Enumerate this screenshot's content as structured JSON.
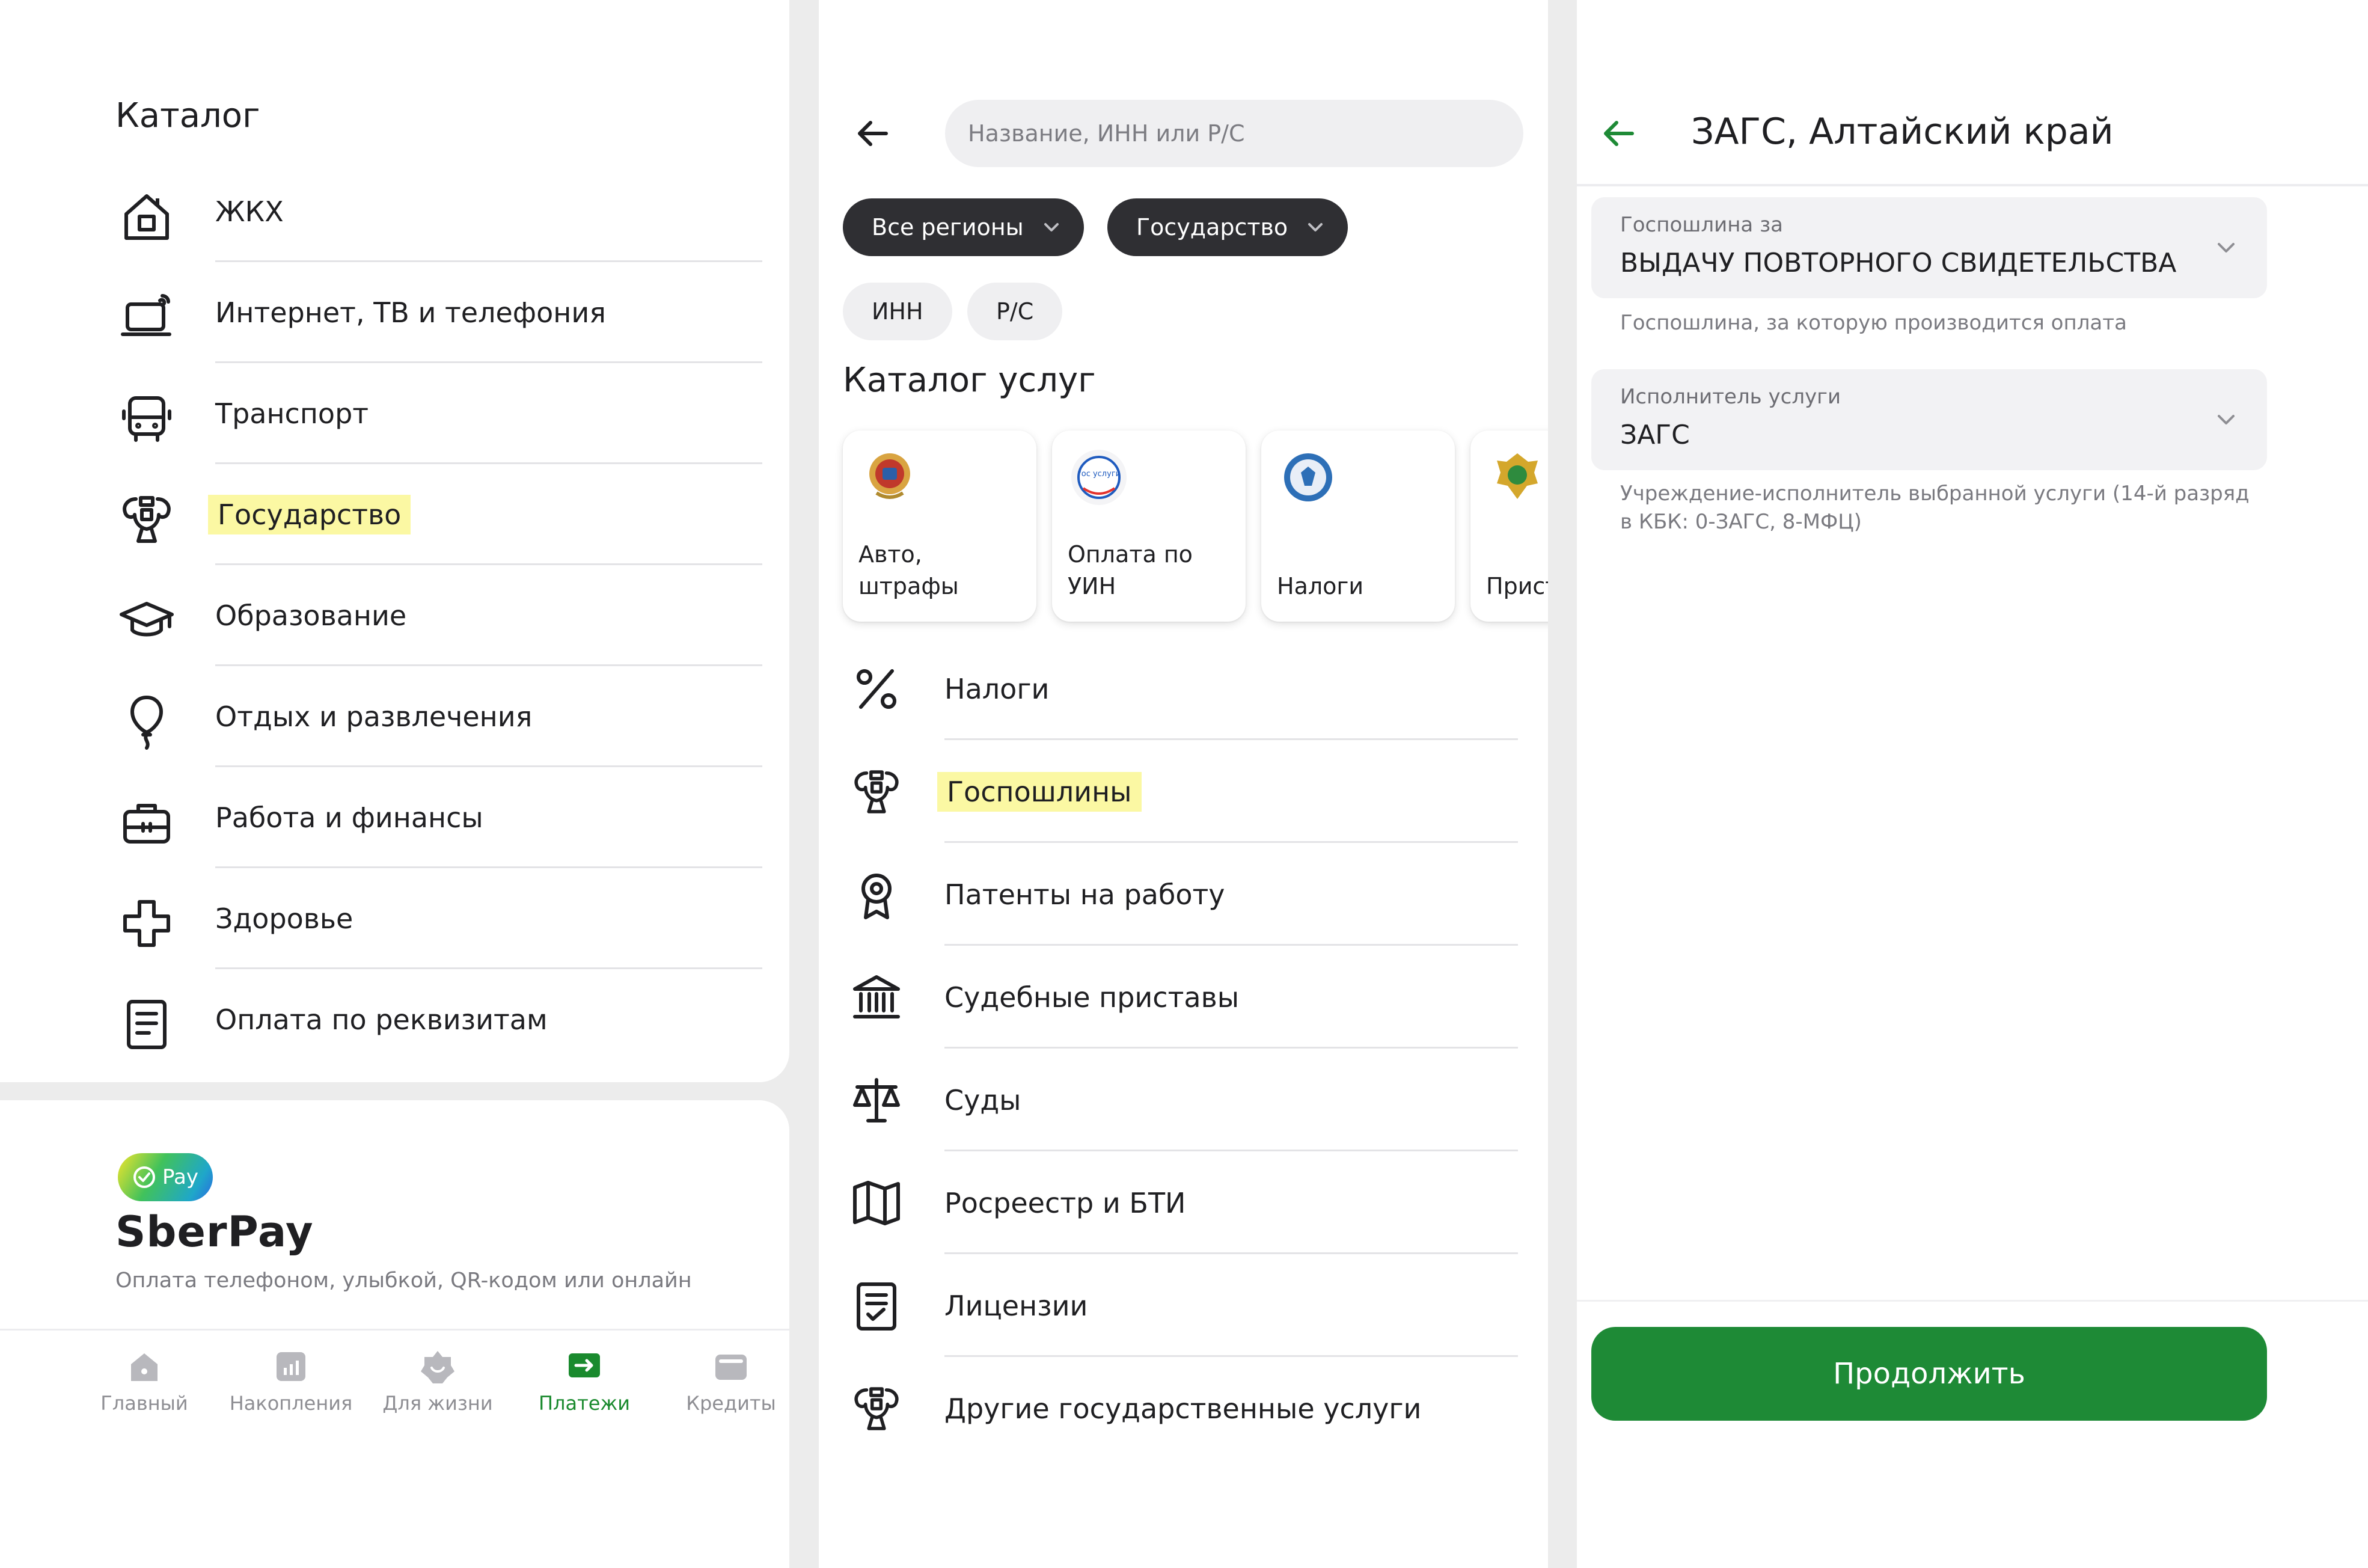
{
  "catalog": {
    "title": "Каталог",
    "items": [
      {
        "label": "ЖКХ",
        "icon": "house-icon"
      },
      {
        "label": "Интернет, ТВ и телефония",
        "icon": "laptop-icon"
      },
      {
        "label": "Транспорт",
        "icon": "bus-icon"
      },
      {
        "label": "Государство",
        "icon": "emblem-icon",
        "highlighted": true
      },
      {
        "label": "Образование",
        "icon": "graduation-cap-icon"
      },
      {
        "label": "Отдых и развлечения",
        "icon": "balloon-icon"
      },
      {
        "label": "Работа и финансы",
        "icon": "briefcase-icon"
      },
      {
        "label": "Здоровье",
        "icon": "medical-cross-icon"
      },
      {
        "label": "Оплата по реквизитам",
        "icon": "document-icon"
      }
    ]
  },
  "sberpay": {
    "badge": "Pay",
    "title": "SberPay",
    "subtitle": "Оплата телефоном, улыбкой, QR-кодом или онлайн"
  },
  "tabbar": {
    "tabs": [
      {
        "label": "Главный",
        "icon": "home-icon"
      },
      {
        "label": "Накопления",
        "icon": "chart-icon"
      },
      {
        "label": "Для жизни",
        "icon": "flower-icon"
      },
      {
        "label": "Платежи",
        "icon": "transfer-icon",
        "active": true
      },
      {
        "label": "Кредиты",
        "icon": "wallet-icon"
      }
    ]
  },
  "services": {
    "search_placeholder": "Название, ИНН или Р/С",
    "filters": [
      "Все регионы",
      "Государство"
    ],
    "quick_filters": [
      "ИНН",
      "Р/С"
    ],
    "title": "Каталог услуг",
    "cards": [
      {
        "label": "Авто, штрафы",
        "icon": "traffic-police-emblem-icon"
      },
      {
        "label": "Оплата по\nУИН",
        "icon": "gosuslugi-icon",
        "icon_text": "гос услуги"
      },
      {
        "label": "Налоги",
        "icon": "tax-service-emblem-icon"
      },
      {
        "label": "Прист",
        "icon": "bailiffs-emblem-icon"
      }
    ],
    "items": [
      {
        "label": "Налоги",
        "icon": "percent-icon"
      },
      {
        "label": "Госпошлины",
        "icon": "emblem-icon",
        "highlighted": true
      },
      {
        "label": "Патенты на работу",
        "icon": "rosette-icon"
      },
      {
        "label": "Судебные приставы",
        "icon": "bank-building-icon"
      },
      {
        "label": "Суды",
        "icon": "scales-icon"
      },
      {
        "label": "Росреестр и БТИ",
        "icon": "map-icon"
      },
      {
        "label": "Лицензии",
        "icon": "checklist-icon"
      },
      {
        "label": "Другие государственные услуги",
        "icon": "emblem-icon"
      }
    ]
  },
  "payment_form": {
    "title": "ЗАГС, Алтайский край",
    "fields": [
      {
        "label": "Госпошлина за",
        "value": "ВЫДАЧУ ПОВТОРНОГО СВИДЕТЕЛЬСТВА",
        "hint": "Госпошлина, за которую производится оплата"
      },
      {
        "label": "Исполнитель услуги",
        "value": "ЗАГС",
        "hint": "Учреждение-исполнитель выбранной услуги (14-й разряд в КБК: 0-ЗАГС, 8-МФЦ)"
      }
    ],
    "continue_label": "Продолжить"
  },
  "colors": {
    "accent_green": "#1e8a36",
    "highlight": "#fbf8a3",
    "chip_dark": "#2f2f33"
  }
}
